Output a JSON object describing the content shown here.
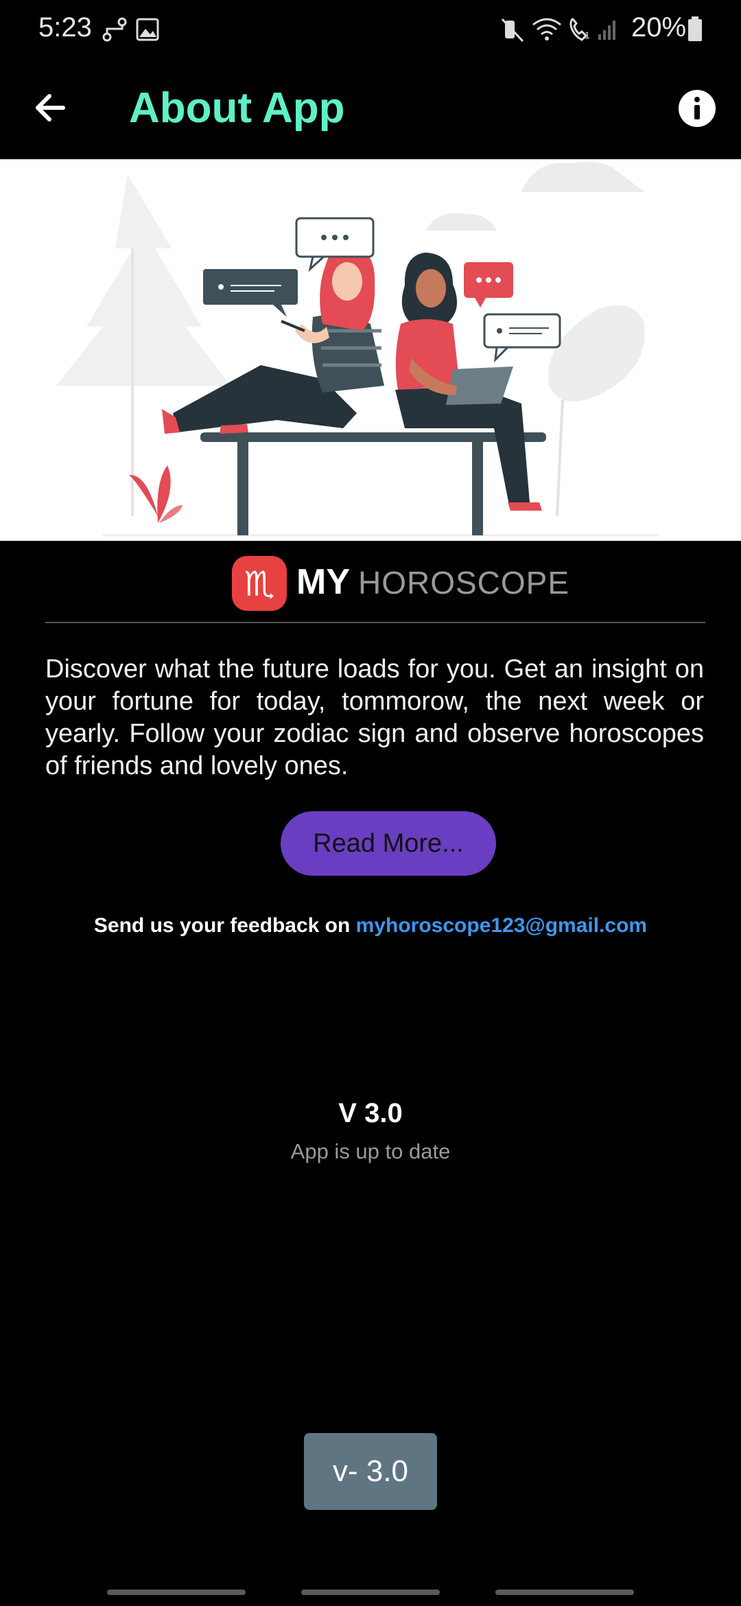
{
  "status_bar": {
    "time": "5:23",
    "battery": "20%",
    "icons": [
      "link-icon",
      "image-icon",
      "mute-icon",
      "wifi-icon",
      "wifi-calling-icon",
      "signal-icon",
      "battery-icon"
    ]
  },
  "app_bar": {
    "title": "About App",
    "back_icon": "arrow-left-icon",
    "info_icon": "info-icon"
  },
  "hero": {
    "illustration": "two-people-chatting-on-bench"
  },
  "brand": {
    "logo_glyph": "♏",
    "name_bold": "MY",
    "name_light": "HOROSCOPE"
  },
  "about": {
    "description": "Discover what the future loads for you. Get an insight on your fortune for today, tommorow, the next week or yearly. Follow your zodiac sign and observe horoscopes of friends and lovely ones.",
    "read_more_label": "Read More..."
  },
  "feedback": {
    "label": "Send us your feedback on",
    "email": "myhoroscope123@gmail.com"
  },
  "version": {
    "title": "V 3.0",
    "status": "App is up to date",
    "chip": "v- 3.0"
  },
  "colors": {
    "title_accent": "#5ff0c8",
    "button_purple": "#6a3ec2",
    "link_blue": "#3d97f0",
    "logo_red": "#e84141",
    "chip_gray": "#5f7582"
  }
}
